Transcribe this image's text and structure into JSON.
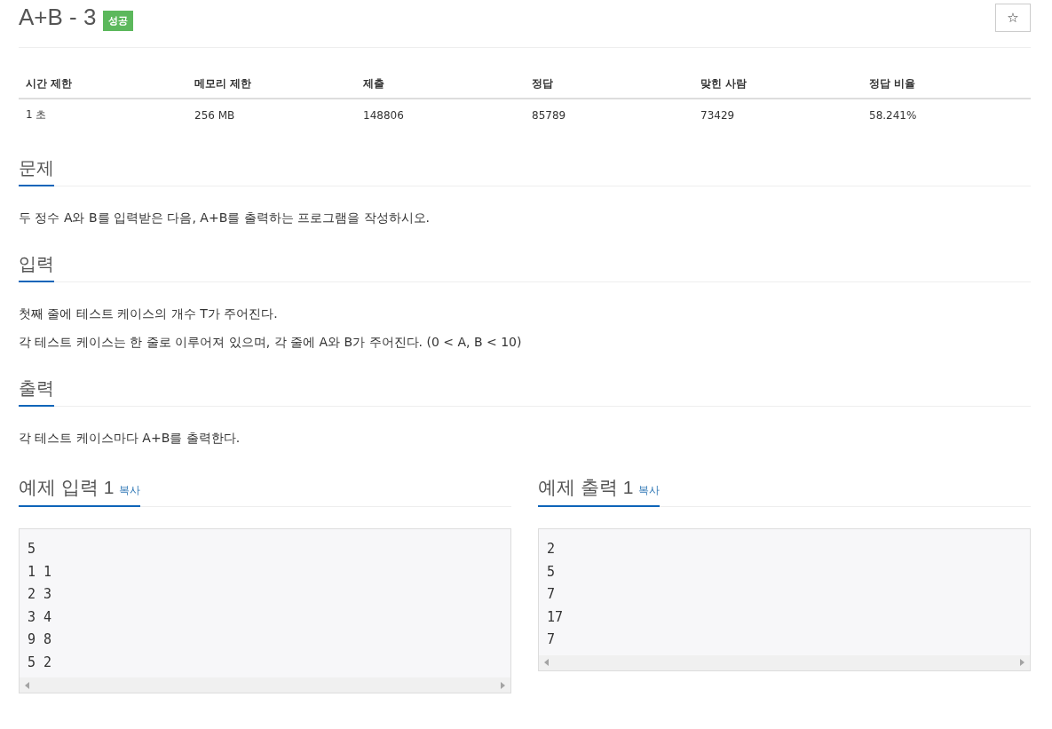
{
  "title": "A+B - 3",
  "status_badge": "성공",
  "star_button": "☆",
  "stats": {
    "columns": [
      "시간 제한",
      "메모리 제한",
      "제출",
      "정답",
      "맞힌 사람",
      "정답 비율"
    ],
    "values": [
      "1 초",
      "256 MB",
      "148806",
      "85789",
      "73429",
      "58.241%"
    ]
  },
  "sections": [
    {
      "title": "문제",
      "paragraphs": [
        "두 정수 A와 B를 입력받은 다음, A+B를 출력하는 프로그램을 작성하시오."
      ]
    },
    {
      "title": "입력",
      "paragraphs": [
        "첫째 줄에 테스트 케이스의 개수 T가 주어진다.",
        "각 테스트 케이스는 한 줄로 이루어져 있으며, 각 줄에 A와 B가 주어진다. (0 < A, B < 10)"
      ]
    },
    {
      "title": "출력",
      "paragraphs": [
        "각 테스트 케이스마다 A+B를 출력한다."
      ]
    }
  ],
  "samples": [
    {
      "title": "예제 입력 1",
      "copy": "복사",
      "lines": [
        "5",
        "1 1",
        "2 3",
        "3 4",
        "9 8",
        "5 2"
      ]
    },
    {
      "title": "예제 출력 1",
      "copy": "복사",
      "lines": [
        "2",
        "5",
        "7",
        "17",
        "7"
      ]
    }
  ]
}
